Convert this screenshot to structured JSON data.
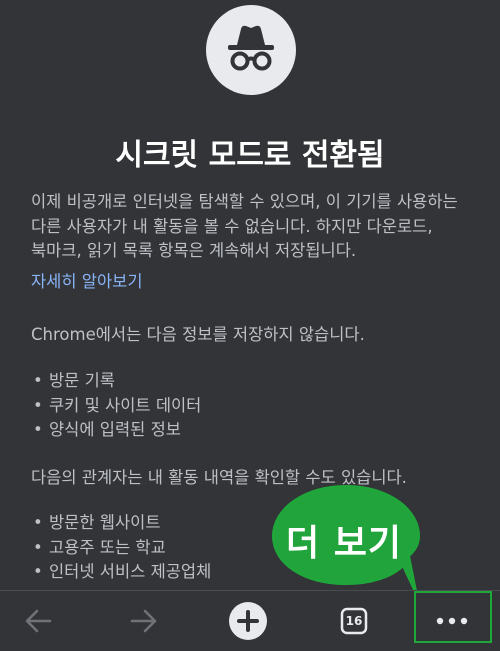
{
  "header": {
    "icon": "incognito-icon",
    "title": "시크릿 모드로 전환됨"
  },
  "main": {
    "description_lines": [
      "이제 비공개로 인터넷을 탐색할 수 있으며, 이 기기를 사용하는",
      "다른 사용자가 내 활동을 볼 수 없습니다. 하지만 다운로드,",
      "북마크, 읽기 목록 항목은 계속해서 저장됩니다."
    ],
    "learn_more": "자세히 알아보기",
    "not_saved": {
      "title": "Chrome에서는 다음 정보를 저장하지 않습니다.",
      "items": [
        "방문 기록",
        "쿠키 및 사이트 데이터",
        "양식에 입력된 정보"
      ]
    },
    "may_see": {
      "title": "다음의 관계자는 내 활동 내역을 확인할 수도 있습니다.",
      "items": [
        "방문한 웹사이트",
        "고용주 또는 학교",
        "인터넷 서비스 제공업체"
      ]
    }
  },
  "callout": {
    "text": "더 보기",
    "color": "#1fa83a"
  },
  "toolbar": {
    "back": "arrow-left-icon",
    "forward": "arrow-right-icon",
    "new_tab": "plus-icon",
    "tab_count": "16",
    "more": "more-horizontal-icon"
  },
  "colors": {
    "background": "#333438",
    "text": "#bdc1c6",
    "title": "#ffffff",
    "link": "#8ab4f8",
    "highlight": "#1fa83a"
  }
}
